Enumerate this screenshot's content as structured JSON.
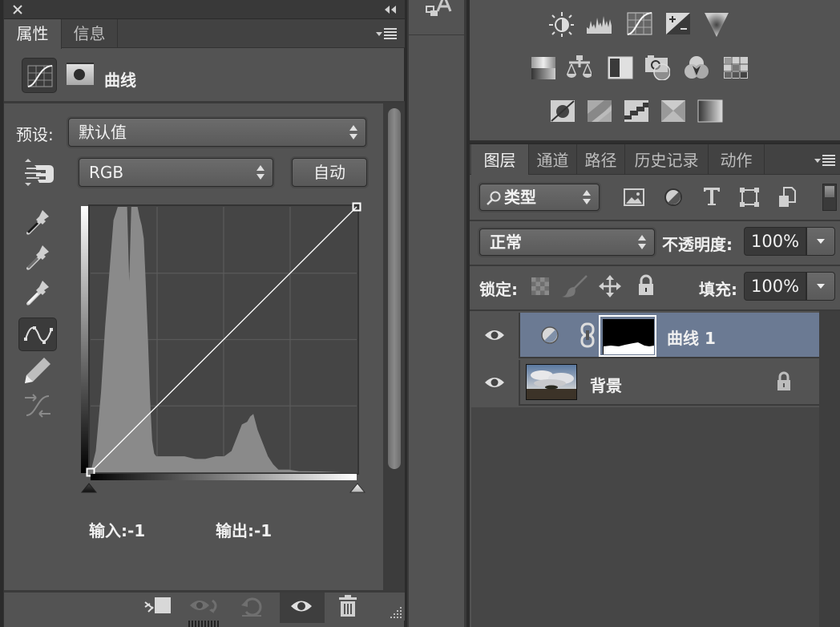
{
  "properties_panel": {
    "close_icon": "close-icon",
    "collapse_icon": "double-chevron-left-icon",
    "tabs": [
      {
        "label": "属性",
        "active": true
      },
      {
        "label": "信息",
        "active": false
      }
    ],
    "panel_menu_icon": "panel-menu-icon",
    "adjustment_title": "曲线",
    "preset_label": "预设:",
    "preset_value": "默认值",
    "channel_value": "RGB",
    "auto_button": "自动",
    "tools": [
      {
        "name": "on-image-adjust-tool"
      },
      {
        "name": "black-point-eyedropper"
      },
      {
        "name": "gray-point-eyedropper"
      },
      {
        "name": "white-point-eyedropper"
      },
      {
        "name": "curve-points-tool",
        "active": true
      },
      {
        "name": "pencil-draw-tool"
      },
      {
        "name": "smooth-curve-tool"
      }
    ],
    "input_label": "输入:",
    "input_value": "-1",
    "output_label": "输出:",
    "output_value": "-1",
    "footer_buttons": [
      {
        "name": "clip-to-layer"
      },
      {
        "name": "view-previous-state"
      },
      {
        "name": "reset-defaults"
      },
      {
        "name": "toggle-visibility",
        "active": true
      },
      {
        "name": "delete-adjustment"
      }
    ]
  },
  "chart_data": {
    "type": "area",
    "title": "Curves (RGB)",
    "xlabel": "",
    "ylabel": "",
    "xlim": [
      0,
      255
    ],
    "ylim": [
      0,
      255
    ],
    "grid": "4x4",
    "histogram": {
      "x": [
        0,
        5,
        10,
        14,
        18,
        22,
        26,
        29,
        31,
        33,
        35,
        37,
        39,
        41,
        43,
        45,
        47,
        49,
        51,
        53,
        55,
        57,
        59,
        61,
        63,
        66,
        70,
        80,
        90,
        100,
        110,
        120,
        128,
        135,
        140,
        145,
        150,
        153,
        156,
        160,
        165,
        170,
        175,
        180,
        190,
        200,
        220,
        240,
        255
      ],
      "values": [
        0,
        8,
        30,
        55,
        75,
        95,
        100,
        100,
        100,
        100,
        100,
        72,
        100,
        100,
        100,
        100,
        96,
        93,
        88,
        70,
        50,
        28,
        12,
        7,
        6,
        6,
        6,
        6,
        6,
        5,
        5,
        6,
        6,
        8,
        13,
        18,
        19,
        21,
        22,
        16,
        11,
        6,
        3,
        1,
        1,
        0.4,
        0.3,
        0,
        0
      ]
    },
    "curve_points": [
      [
        0,
        0
      ],
      [
        255,
        255
      ]
    ],
    "input_value": -1,
    "output_value": -1
  },
  "middle_strip": {
    "icon": "character-paragraph-icon"
  },
  "adjustments_panel": {
    "rows": [
      [
        "brightness-contrast",
        "levels",
        "curves",
        "exposure",
        "vibrance"
      ],
      [
        "hue-saturation",
        "color-balance",
        "black-white",
        "photo-filter",
        "channel-mixer",
        "color-lookup"
      ],
      [
        "invert",
        "posterize",
        "threshold",
        "selective-color",
        "gradient-map"
      ]
    ]
  },
  "layers_panel": {
    "tabs": [
      {
        "label": "图层",
        "active": true
      },
      {
        "label": "通道",
        "active": false
      },
      {
        "label": "路径",
        "active": false
      },
      {
        "label": "历史记录",
        "active": false
      },
      {
        "label": "动作",
        "active": false
      }
    ],
    "filter_kind": "类型",
    "filter_icons": [
      "pixel-layer-filter",
      "adjustment-layer-filter",
      "type-layer-filter",
      "shape-layer-filter",
      "smart-object-filter"
    ],
    "blend_mode": "正常",
    "opacity_label": "不透明度:",
    "opacity_value": "100%",
    "lock_label": "锁定:",
    "lock_icons": [
      "lock-transparent-pixels",
      "lock-image-pixels",
      "lock-position",
      "lock-all"
    ],
    "fill_label": "填充:",
    "fill_value": "100%",
    "layers": [
      {
        "name": "曲线 1",
        "type": "adjustment",
        "visible": true,
        "selected": true
      },
      {
        "name": "背景",
        "type": "image",
        "visible": true,
        "selected": false,
        "locked": true
      }
    ],
    "colors": {
      "selected_row": "#6b7a93"
    }
  }
}
